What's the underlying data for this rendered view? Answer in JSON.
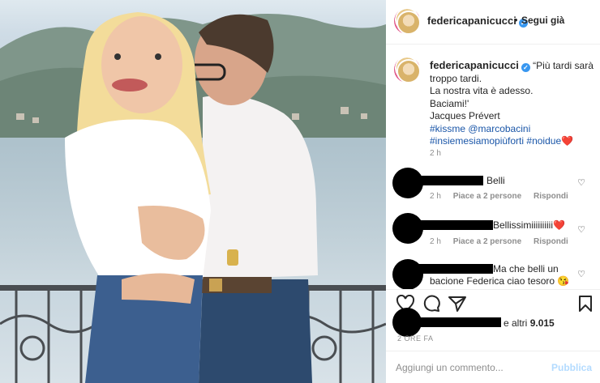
{
  "photo": {
    "alt": "couple photo on lakeside balcony"
  },
  "header": {
    "username": "federicapanicucci",
    "separator": "•",
    "follow_label": "Segui già"
  },
  "caption": {
    "username": "federicapanicucci",
    "lines": [
      "“Più tardi sarà",
      "troppo tardi.",
      "La nostra vita è adesso.",
      "Baciami!'",
      "Jacques Prévert"
    ],
    "tags_line1": [
      "#kissme",
      "@marcobacini"
    ],
    "tags_line2": [
      "#insiemesiamopiùforti",
      "#noidue"
    ],
    "emoji": "❤️",
    "time": "2 h"
  },
  "comments": [
    {
      "text": "Belli",
      "time": "2 h",
      "likes": "Piace a 2 persone",
      "reply": "Rispondi"
    },
    {
      "text": "Bellissimiiiiiiiiii",
      "emoji": "❤️",
      "time": "2 h",
      "likes": "Piace a 2 persone",
      "reply": "Rispondi"
    },
    {
      "text": "Ma che belli un",
      "text2": "bacione Federica ciao tesoro 😘"
    }
  ],
  "likes": {
    "text": "e altri",
    "count": "9.015"
  },
  "posted_ago": "2 ORE FA",
  "add_comment": {
    "placeholder": "Aggiungi un commento...",
    "publish_label": "Pubblica"
  },
  "icons": [
    "heart-icon",
    "comment-icon",
    "share-icon",
    "bookmark-icon",
    "verified-badge-icon",
    "comment-like-heart-icon"
  ],
  "colors": {
    "link": "#1a56a8",
    "verified": "#3897f0",
    "publish": "#b3dbff",
    "muted": "#8e8e8e"
  }
}
